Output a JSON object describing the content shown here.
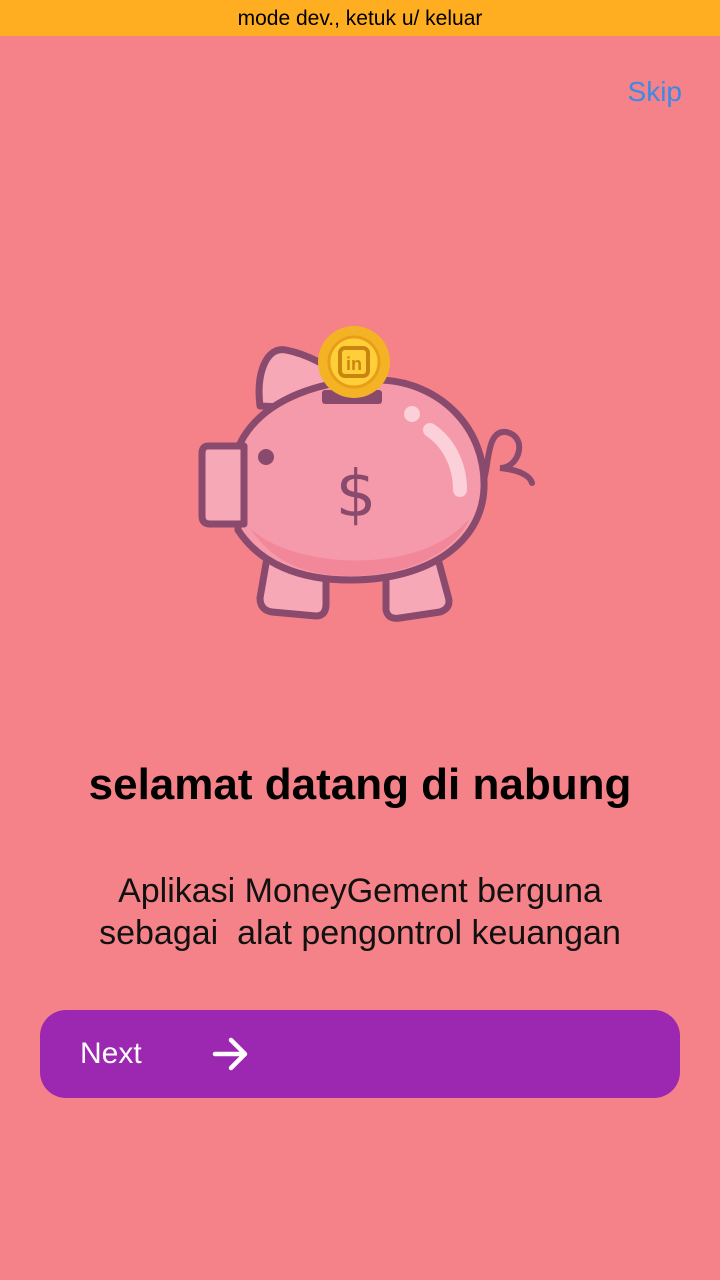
{
  "dev_banner": {
    "text": "mode dev., ketuk u/ keluar"
  },
  "onboarding": {
    "skip_label": "Skip",
    "illustration": {
      "icon": "piggy-bank-with-coin",
      "coin_symbol": "in",
      "body_symbol": "$"
    },
    "title": "selamat datang di nabung",
    "description_lines": [
      "Aplikasi MoneyGement berguna",
      "sebagai  alat pengontrol keuangan"
    ],
    "next_label": "Next",
    "next_icon": "arrow-right-icon"
  },
  "colors": {
    "background": "#f58288",
    "banner": "#ffad21",
    "skip": "#3b8ae6",
    "button": "#9c27b0",
    "pig_body": "#f59aaa",
    "pig_outline": "#8a4a6e",
    "coin": "#f4b324"
  }
}
